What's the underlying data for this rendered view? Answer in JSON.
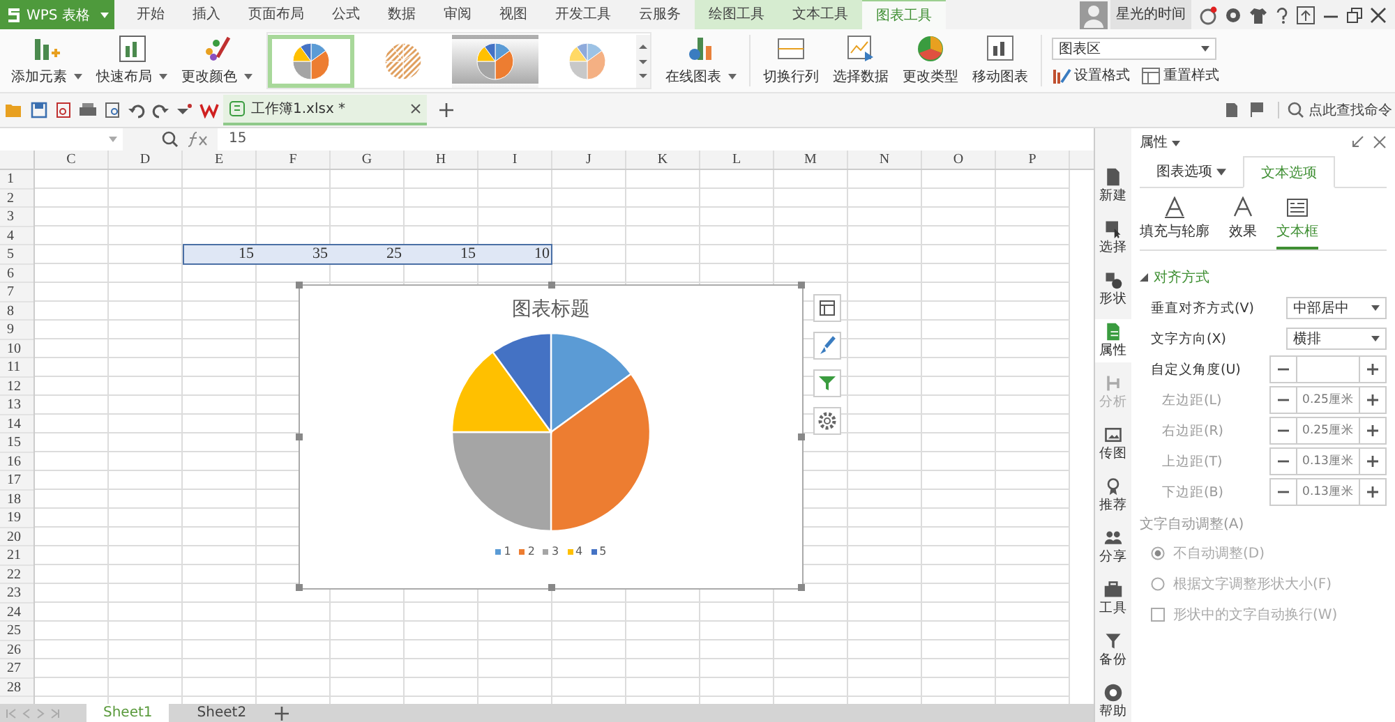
{
  "app_menu": {
    "label": "WPS 表格"
  },
  "menu_tabs": [
    {
      "label": "开始",
      "kind": "normal",
      "selected": false
    },
    {
      "label": "插入",
      "kind": "normal",
      "selected": false
    },
    {
      "label": "页面布局",
      "kind": "normal",
      "selected": false
    },
    {
      "label": "公式",
      "kind": "normal",
      "selected": false
    },
    {
      "label": "数据",
      "kind": "normal",
      "selected": false
    },
    {
      "label": "审阅",
      "kind": "normal",
      "selected": false
    },
    {
      "label": "视图",
      "kind": "normal",
      "selected": false
    },
    {
      "label": "开发工具",
      "kind": "normal",
      "selected": false
    },
    {
      "label": "云服务",
      "kind": "normal",
      "selected": false
    },
    {
      "label": "绘图工具",
      "kind": "context",
      "selected": false
    },
    {
      "label": "文本工具",
      "kind": "context",
      "selected": false
    },
    {
      "label": "图表工具",
      "kind": "context",
      "selected": true
    }
  ],
  "account": {
    "user": "星光的时间"
  },
  "ribbon": {
    "left_buttons": [
      {
        "label": "添加元素",
        "dropdown": true
      },
      {
        "label": "快速布局",
        "dropdown": true
      },
      {
        "label": "更改颜色",
        "dropdown": true
      }
    ],
    "chart_styles": [
      {
        "kind": "plain",
        "selected": true
      },
      {
        "kind": "hatched",
        "selected": false
      },
      {
        "kind": "shaded",
        "selected": false
      },
      {
        "kind": "light",
        "selected": false
      }
    ],
    "online_button": {
      "label": "在线图表",
      "dropdown": true
    },
    "right_buttons": [
      {
        "label": "切换行列"
      },
      {
        "label": "选择数据"
      },
      {
        "label": "更改类型"
      },
      {
        "label": "移动图表"
      }
    ],
    "element_select": {
      "value": "图表区"
    },
    "format_buttons": [
      {
        "label": "设置格式"
      },
      {
        "label": "重置样式"
      }
    ]
  },
  "doc_tabs": [
    {
      "label": "工作簿1.xlsx *",
      "selected": true
    }
  ],
  "command_search": {
    "placeholder": "点此查找命令"
  },
  "formula_bar": {
    "value": "15"
  },
  "sheet": {
    "columns": [
      "C",
      "D",
      "E",
      "F",
      "G",
      "H",
      "I",
      "J",
      "K",
      "L",
      "M",
      "N",
      "O",
      "P"
    ],
    "rows": [
      {
        "label": "1"
      },
      {
        "label": "2"
      },
      {
        "label": "3"
      },
      {
        "label": "4"
      },
      {
        "label": "5",
        "selected": true,
        "cells": [
          null,
          null,
          "15",
          "35",
          "25",
          "15",
          "10"
        ]
      },
      {
        "label": "6"
      },
      {
        "label": "7"
      },
      {
        "label": "8"
      },
      {
        "label": "9"
      },
      {
        "label": "10"
      },
      {
        "label": "11"
      },
      {
        "label": "12"
      },
      {
        "label": "13"
      },
      {
        "label": "14"
      },
      {
        "label": "15"
      },
      {
        "label": "16"
      },
      {
        "label": "17"
      },
      {
        "label": "18"
      },
      {
        "label": "19"
      },
      {
        "label": "20"
      },
      {
        "label": "21"
      },
      {
        "label": "22"
      },
      {
        "label": "23"
      },
      {
        "label": "24"
      },
      {
        "label": "25"
      },
      {
        "label": "26"
      },
      {
        "label": "27"
      },
      {
        "label": "28"
      }
    ]
  },
  "chart": {
    "chart_data": {
      "type": "pie",
      "title": "图表标题",
      "legend": "bottom",
      "categories": [
        "1",
        "2",
        "3",
        "4",
        "5"
      ],
      "values": [
        15,
        35,
        25,
        15,
        10
      ],
      "colors": [
        "#5b9bd5",
        "#ed7d31",
        "#a5a5a5",
        "#ffc000",
        "#4472c4"
      ]
    }
  },
  "sheet_tabs": [
    {
      "label": "Sheet1",
      "selected": true
    },
    {
      "label": "Sheet2",
      "selected": false
    }
  ],
  "side_dock": [
    {
      "label": "新建",
      "selected": false,
      "disabled": false
    },
    {
      "label": "选择",
      "selected": false,
      "disabled": false
    },
    {
      "label": "形状",
      "selected": false,
      "disabled": false
    },
    {
      "label": "属性",
      "selected": true,
      "disabled": false
    },
    {
      "label": "分析",
      "selected": false,
      "disabled": true
    },
    {
      "label": "传图",
      "selected": false,
      "disabled": false
    },
    {
      "label": "推荐",
      "selected": false,
      "disabled": false
    },
    {
      "label": "分享",
      "selected": false,
      "disabled": false
    },
    {
      "label": "工具",
      "selected": false,
      "disabled": false
    },
    {
      "label": "备份",
      "selected": false,
      "disabled": false
    },
    {
      "label": "帮助",
      "selected": false,
      "disabled": false
    }
  ],
  "properties_panel": {
    "title": "属性",
    "tabs": [
      {
        "label": "图表选项",
        "selected": false
      },
      {
        "label": "文本选项",
        "selected": true
      }
    ],
    "subtabs": [
      {
        "label": "填充与轮廓",
        "selected": false
      },
      {
        "label": "效果",
        "selected": false
      },
      {
        "label": "文本框",
        "selected": true
      }
    ],
    "section": {
      "title": "对齐方式",
      "expanded": true
    },
    "fields": [
      {
        "kind": "select",
        "label": "垂直对齐方式(V)",
        "value": "中部居中",
        "disabled": false
      },
      {
        "kind": "select",
        "label": "文字方向(X)",
        "value": "横排",
        "disabled": false
      },
      {
        "kind": "spinner",
        "label": "自定义角度(U)",
        "disabled": false
      },
      {
        "kind": "spinner",
        "label": "左边距(L)",
        "value": "0.25厘米",
        "disabled": true
      },
      {
        "kind": "spinner",
        "label": "右边距(R)",
        "value": "0.25厘米",
        "disabled": true
      },
      {
        "kind": "spinner",
        "label": "上边距(T)",
        "value": "0.13厘米",
        "disabled": true
      },
      {
        "kind": "spinner",
        "label": "下边距(B)",
        "value": "0.13厘米",
        "disabled": true
      }
    ],
    "autofit": {
      "label": "文字自动调整(A)",
      "options": [
        {
          "kind": "radio",
          "label": "不自动调整(D)",
          "checked": true
        },
        {
          "kind": "radio",
          "label": "根据文字调整形状大小(F)",
          "checked": false
        },
        {
          "kind": "checkbox",
          "label": "形状中的文字自动换行(W)",
          "checked": false
        }
      ]
    }
  }
}
